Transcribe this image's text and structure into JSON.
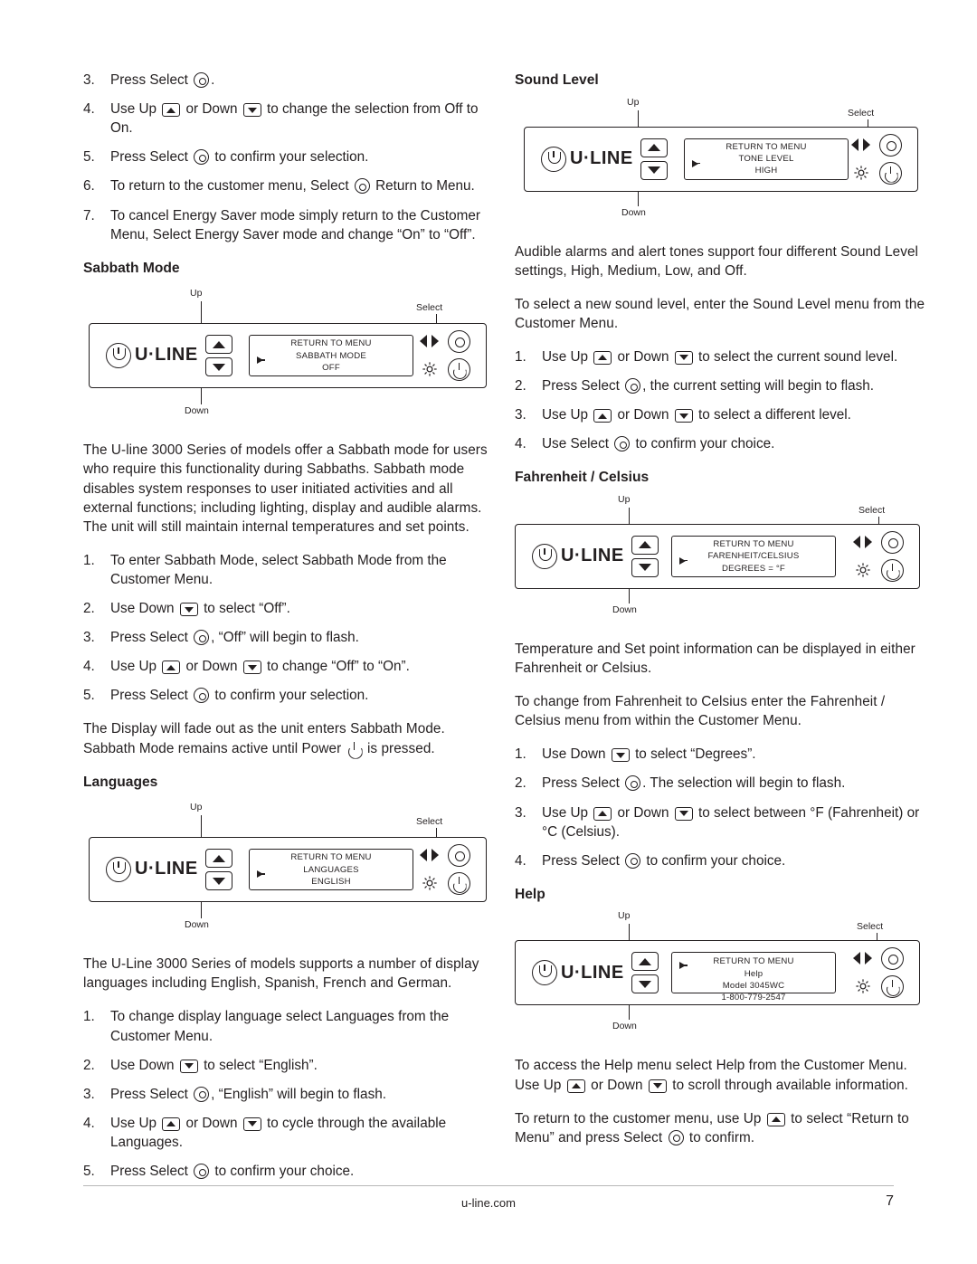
{
  "document": {
    "footer_site": "u-line.com",
    "page_number": "7"
  },
  "left_column": {
    "top_steps": [
      {
        "num": "3.",
        "text_before": "Press Select",
        "icon": "select-icon",
        "text_after": "."
      },
      {
        "num": "4.",
        "text_before": "Use Up",
        "icon": "up-icon",
        "mid": "or Down",
        "icon2": "down-icon",
        "text_after": "to change the selection from Off to On."
      },
      {
        "num": "5.",
        "text_before": "Press Select",
        "icon": "select-icon",
        "text_after": "to confirm your selection."
      },
      {
        "num": "6.",
        "text_before": "To return to the customer menu, Select",
        "icon": "select-icon",
        "text_after": "Return to Menu."
      },
      {
        "num": "7.",
        "text_before": "To cancel Energy Saver mode simply return to the Customer Menu, Select Energy Saver mode and change “On” to “Off”."
      }
    ],
    "sabbath": {
      "heading": "Sabbath Mode",
      "diagram": {
        "logo_text": "U·LINE",
        "label_up": "Up",
        "label_down": "Down",
        "label_select": "Select",
        "lcd_line1": "RETURN TO MENU",
        "lcd_line2": "SABBATH MODE",
        "lcd_line3": "OFF"
      },
      "paragraph": "The U-line 3000 Series of models offer a Sabbath mode for users who require this functionality during Sabbaths. Sabbath mode disables system responses to user initiated activities and all external functions; including lighting, display and audible alarms. The unit will still maintain internal temperatures and set points.",
      "steps": [
        {
          "num": "1.",
          "text_before": "To enter Sabbath Mode, select Sabbath Mode from the Customer Menu."
        },
        {
          "num": "2.",
          "text_before": "Use Down",
          "icon": "down-icon",
          "text_after": "to select “Off”."
        },
        {
          "num": "3.",
          "text_before": "Press Select",
          "icon": "select-icon",
          "text_after": ", “Off” will begin to flash."
        },
        {
          "num": "4.",
          "text_before": "Use Up",
          "icon": "up-icon",
          "mid": "or Down",
          "icon2": "down-icon",
          "text_after": "to change “Off” to “On”."
        },
        {
          "num": "5.",
          "text_before": "Press Select",
          "icon": "select-icon",
          "text_after": "to confirm your selection."
        }
      ],
      "closing_before": "The Display will fade out as the unit enters Sabbath Mode. Sabbath Mode remains active until Power",
      "closing_icon": "power-icon",
      "closing_after": "is pressed."
    },
    "languages": {
      "heading": "Languages",
      "diagram": {
        "logo_text": "U·LINE",
        "label_up": "Up",
        "label_down": "Down",
        "label_select": "Select",
        "lcd_line1": "RETURN TO MENU",
        "lcd_line2": "LANGUAGES",
        "lcd_line3": "ENGLISH"
      },
      "paragraph": "The U-Line 3000 Series of models supports a number of display languages including English, Spanish, French and German.",
      "steps": [
        {
          "num": "1.",
          "text_before": "To change display language select Languages from the Customer Menu."
        },
        {
          "num": "2.",
          "text_before": "Use Down",
          "icon": "down-icon",
          "text_after": "to select “English”."
        },
        {
          "num": "3.",
          "text_before": "Press Select",
          "icon": "select-icon",
          "text_after": ", “English” will begin to flash."
        },
        {
          "num": "4.",
          "text_before": "Use Up",
          "icon": "up-icon",
          "mid": "or Down",
          "icon2": "down-icon",
          "text_after": "to cycle through the available Languages."
        },
        {
          "num": "5.",
          "text_before": "Press Select",
          "icon": "select-icon",
          "text_after": "to confirm your choice."
        }
      ]
    }
  },
  "right_column": {
    "sound_level": {
      "heading": "Sound Level",
      "diagram": {
        "logo_text": "U·LINE",
        "label_up": "Up",
        "label_down": "Down",
        "label_select": "Select",
        "lcd_line1": "RETURN TO MENU",
        "lcd_line2": "TONE LEVEL",
        "lcd_line3": "HIGH"
      },
      "paragraph1": "Audible alarms and alert tones support four different Sound Level settings, High, Medium, Low, and Off.",
      "paragraph2": "To select a new sound level, enter the Sound Level menu from the Customer Menu.",
      "steps": [
        {
          "num": "1.",
          "text_before": "Use Up",
          "icon": "up-icon",
          "mid": "or Down",
          "icon2": "down-icon",
          "text_after": "to select the current sound level."
        },
        {
          "num": "2.",
          "text_before": "Press Select",
          "icon": "select-icon",
          "text_after": ", the current setting will begin to flash."
        },
        {
          "num": "3.",
          "text_before": "Use Up",
          "icon": "up-icon",
          "mid": "or Down",
          "icon2": "down-icon",
          "text_after": "to select a different level."
        },
        {
          "num": "4.",
          "text_before": "Use Select",
          "icon": "select-icon",
          "text_after": "to confirm your choice."
        }
      ]
    },
    "fahrenheit_celsius": {
      "heading": "Fahrenheit / Celsius",
      "diagram": {
        "logo_text": "U·LINE",
        "label_up": "Up",
        "label_down": "Down",
        "label_select": "Select",
        "lcd_line1": "RETURN TO MENU",
        "lcd_line2": "FARENHEIT/CELSIUS",
        "lcd_line3": "DEGREES = °F"
      },
      "paragraph1": "Temperature and Set point information can be displayed in either Fahrenheit or Celsius.",
      "paragraph2": "To change from Fahrenheit to Celsius enter the Fahrenheit / Celsius menu from within the Customer Menu.",
      "steps": [
        {
          "num": "1.",
          "text_before": "Use Down",
          "icon": "down-icon",
          "text_after": "to select “Degrees”."
        },
        {
          "num": "2.",
          "text_before": "Press Select",
          "icon": "select-icon",
          "text_after": ". The selection will begin to flash."
        },
        {
          "num": "3.",
          "text_before": "Use Up",
          "icon": "up-icon",
          "mid": "or Down",
          "icon2": "down-icon",
          "text_after": "to select between °F (Fahrenheit) or °C (Celsius)."
        },
        {
          "num": "4.",
          "text_before": "Press Select",
          "icon": "select-icon",
          "text_after": "to confirm your choice."
        }
      ]
    },
    "help": {
      "heading": "Help",
      "diagram": {
        "logo_text": "U·LINE",
        "label_up": "Up",
        "label_down": "Down",
        "label_select": "Select",
        "lcd_line1": "RETURN TO MENU",
        "lcd_line2": "Help",
        "lcd_line3": "Model 3045WC",
        "lcd_line4": "1-800-779-2547"
      },
      "paragraph1_a": "To access the Help menu select Help from the Customer Menu. Use Up",
      "paragraph1_icon1": "up-icon",
      "paragraph1_b": "or Down",
      "paragraph1_icon2": "down-icon",
      "paragraph1_c": "to scroll through available information.",
      "paragraph2_a": "To return to the customer menu, use Up",
      "paragraph2_icon1": "up-icon",
      "paragraph2_b": "to select “Return to Menu” and press Select",
      "paragraph2_icon2": "select-icon",
      "paragraph2_c": "to confirm."
    }
  }
}
